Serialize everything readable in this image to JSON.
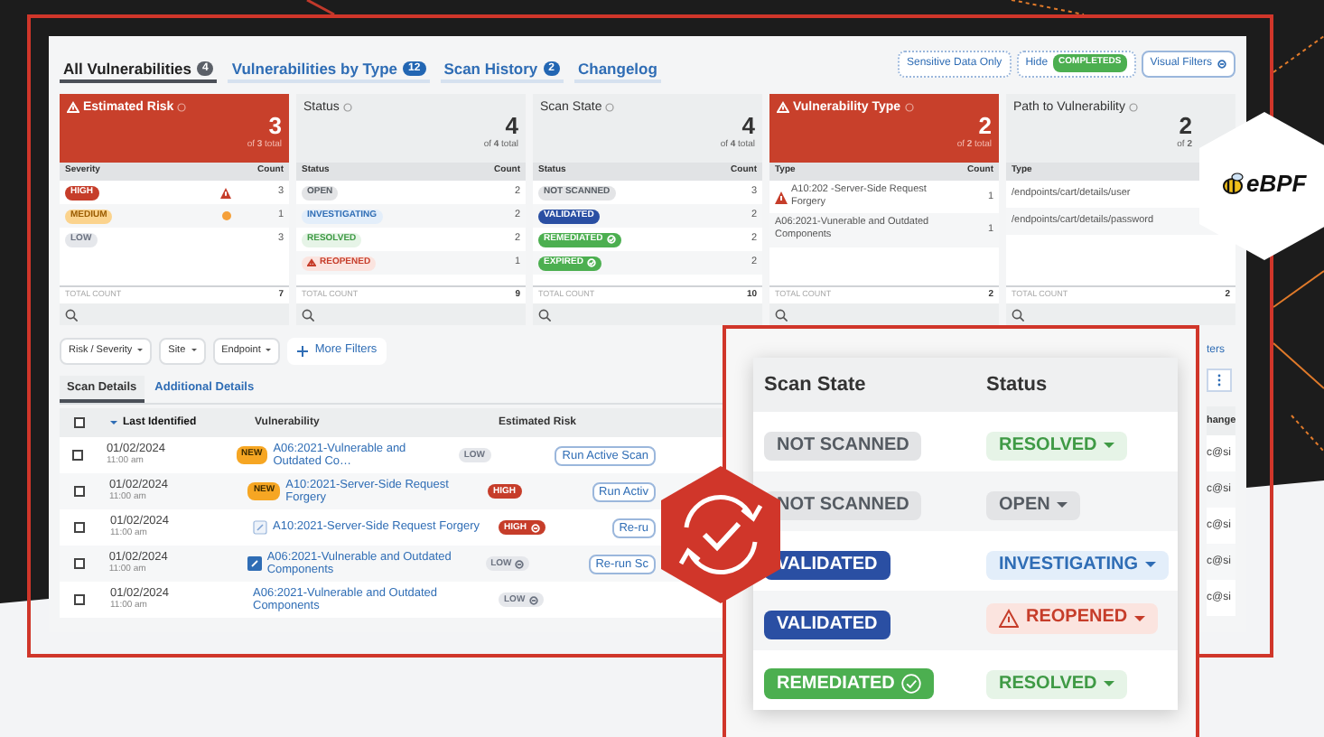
{
  "tabs": [
    {
      "label": "All Vulnerabilities",
      "count": "4",
      "selected": true
    },
    {
      "label": "Vulnerabilities by Type",
      "count": "12",
      "selected": false
    },
    {
      "label": "Scan History",
      "count": "2",
      "selected": false
    },
    {
      "label": "Changelog",
      "selected": false
    }
  ],
  "toolbar_buttons": [
    {
      "kind": "plain",
      "label": "Sensitive Data Only"
    },
    {
      "kind": "toggle",
      "label": "Hide",
      "badge": "COMPLETEDS"
    },
    {
      "kind": "filter",
      "label": "Visual Filters"
    }
  ],
  "cards": [
    {
      "title": "Estimated Risk",
      "alert": true,
      "value": "3",
      "of_text": "of",
      "of_value": "3",
      "of_suffix": "total",
      "columns": [
        "Severity",
        "Count"
      ],
      "rows": [
        {
          "kind": "high",
          "label": "HIGH",
          "count": "3"
        },
        {
          "kind": "medium",
          "label": "MEDIUM",
          "count": "1"
        },
        {
          "kind": "low",
          "label": "LOW",
          "count": "3"
        }
      ],
      "total_label": "TOTAL COUNT",
      "total": "7"
    },
    {
      "title": "Status",
      "alert": false,
      "value": "4",
      "of_text": "of",
      "of_value": "4",
      "of_suffix": "total",
      "columns": [
        "Status",
        "Count"
      ],
      "rows": [
        {
          "kind": "open",
          "label": "OPEN",
          "count": "2"
        },
        {
          "kind": "investigating",
          "label": "INVESTIGATING",
          "count": "2"
        },
        {
          "kind": "resolved",
          "label": "RESOLVED",
          "count": "2"
        },
        {
          "kind": "reopened",
          "label": "REOPENED",
          "count": "1"
        }
      ],
      "total_label": "TOTAL COUNT",
      "total": "9"
    },
    {
      "title": "Scan State",
      "alert": false,
      "value": "4",
      "of_text": "of",
      "of_value": "4",
      "of_suffix": "total",
      "columns": [
        "Status",
        "Count"
      ],
      "rows": [
        {
          "kind": "not_scanned",
          "label": "NOT SCANNED",
          "count": "3"
        },
        {
          "kind": "validated",
          "label": "VALIDATED",
          "count": "2"
        },
        {
          "kind": "remediated",
          "label": "REMEDIATED",
          "count": "2"
        },
        {
          "kind": "expired",
          "label": "EXPIRED",
          "count": "2"
        }
      ],
      "total_label": "TOTAL COUNT",
      "total": "10"
    },
    {
      "title": "Vulnerability Type",
      "alert": true,
      "value": "2",
      "of_text": "of",
      "of_value": "2",
      "of_suffix": "total",
      "columns": [
        "Type",
        "Count"
      ],
      "rows": [
        {
          "kind": "alert_text",
          "label": "A10:202 -Server-Side Request Forgery",
          "count": "1"
        },
        {
          "kind": "text",
          "label": "A06:2021-Vunerable and Outdated Components",
          "count": "1"
        }
      ],
      "total_label": "TOTAL COUNT",
      "total": "2"
    },
    {
      "title": "Path to Vulnerability",
      "alert": false,
      "value": "2",
      "of_text": "of",
      "of_value": "2",
      "columns": [
        "Type"
      ],
      "rows": [
        {
          "kind": "text",
          "label": "/endpoints/cart/details/user"
        },
        {
          "kind": "text",
          "label": "/endpoints/cart/details/password"
        }
      ],
      "total_label": "TOTAL COUNT",
      "total": "2"
    }
  ],
  "filters": [
    "Risk / Severity",
    "Site",
    "Endpoint"
  ],
  "more_filters": "More Filters",
  "detail_tabs": [
    {
      "label": "Scan Details",
      "selected": true
    },
    {
      "label": "Additional Details",
      "selected": false
    }
  ],
  "table": {
    "all_checked": false,
    "columns": [
      {
        "label": "Last Identified",
        "sorted": true
      },
      {
        "label": "Vulnerability",
        "sorted": false
      },
      {
        "label": "Estimated Risk",
        "sorted": false
      }
    ],
    "rows": [
      {
        "kind": "new",
        "checked": false,
        "date": "01/02/2024",
        "time": "11:00 am",
        "tag": "NEW",
        "vulnerability": "A06:2021-Vulnerable and Outdated Co…",
        "risk": {
          "label": "LOW",
          "kind": "low"
        },
        "action": "Run Active Scan"
      },
      {
        "kind": "new",
        "checked": false,
        "date": "01/02/2024",
        "time": "11:00 am",
        "tag": "NEW",
        "vulnerability": "A10:2021-Server-Side Request Forgery",
        "risk": {
          "label": "HIGH",
          "kind": "high"
        },
        "action": "Run Activ"
      },
      {
        "kind": "link_outline",
        "checked": false,
        "date": "01/02/2024",
        "time": "11:00 am",
        "vulnerability": "A10:2021-Server-Side Request Forgery",
        "risk": {
          "label": "HIGH",
          "kind": "high_circled"
        },
        "action": "Re-ru"
      },
      {
        "kind": "link_filled",
        "checked": false,
        "date": "01/02/2024",
        "time": "11:00 am",
        "vulnerability": "A06:2021-Vulnerable and Outdated Components",
        "risk": {
          "label": "LOW",
          "kind": "low_circled"
        },
        "action": "Re-run Sc"
      },
      {
        "kind": "plain",
        "checked": false,
        "date": "01/02/2024",
        "time": "11:00 am",
        "vulnerability": "A06:2021-Vulnerable and Outdated Components",
        "risk": {
          "label": "LOW",
          "kind": "low_circled"
        }
      }
    ]
  },
  "right_edge": {
    "link": "ters",
    "column_header": "hange",
    "cells": [
      "c@si",
      "c@si",
      "c@si",
      "c@si",
      "c@si"
    ]
  },
  "overlay": {
    "columns": [
      "Scan State",
      "Status"
    ],
    "rows": [
      {
        "scan_state": {
          "label": "NOT SCANNED",
          "kind": "not_scanned"
        },
        "status": {
          "label": "RESOLVED",
          "kind": "resolved"
        }
      },
      {
        "scan_state": {
          "label": "NOT SCANNED",
          "kind": "not_scanned"
        },
        "status": {
          "label": "OPEN",
          "kind": "open"
        }
      },
      {
        "scan_state": {
          "label": "VALIDATED",
          "kind": "validated"
        },
        "status": {
          "label": "INVESTIGATING",
          "kind": "investigating"
        }
      },
      {
        "scan_state": {
          "label": "VALIDATED",
          "kind": "validated"
        },
        "status": {
          "label": "REOPENED",
          "kind": "reopened"
        }
      },
      {
        "scan_state": {
          "label": "REMEDIATED",
          "kind": "remediated"
        },
        "status": {
          "label": "RESOLVED",
          "kind": "resolved"
        }
      }
    ]
  },
  "logo": {
    "text": "eBPF"
  }
}
